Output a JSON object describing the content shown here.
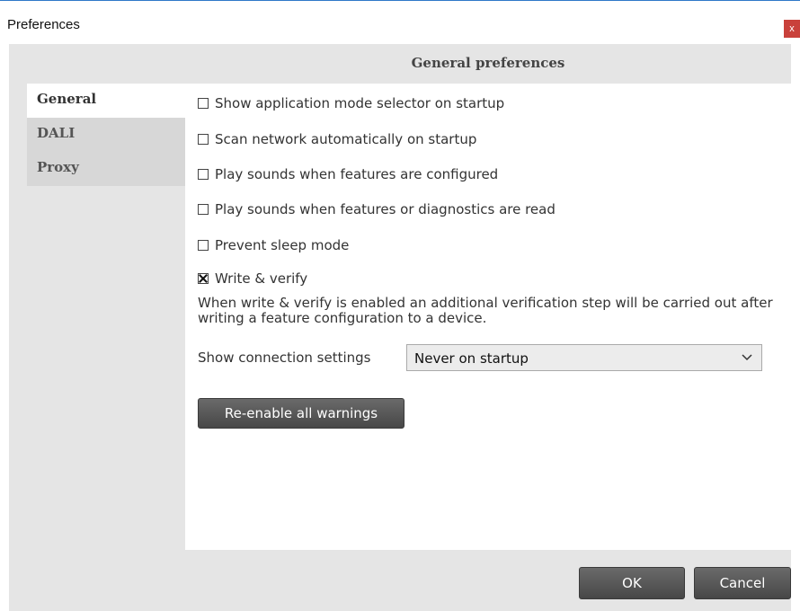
{
  "window": {
    "title": "Preferences",
    "close_label": "x"
  },
  "panel": {
    "heading": "General preferences"
  },
  "nav": {
    "items": [
      {
        "label": "General",
        "active": true
      },
      {
        "label": "DALI",
        "active": false
      },
      {
        "label": "Proxy",
        "active": false
      }
    ]
  },
  "options": [
    {
      "label": "Show application mode selector on startup",
      "checked": false
    },
    {
      "label": "Scan network automatically on startup",
      "checked": false
    },
    {
      "label": "Play sounds when features are configured",
      "checked": false
    },
    {
      "label": "Play sounds when features or diagnostics are read",
      "checked": false
    },
    {
      "label": "Prevent sleep mode",
      "checked": false
    },
    {
      "label": "Write & verify",
      "checked": true
    }
  ],
  "write_verify_description": "When write & verify is enabled an additional verification step will be carried out after writing a feature configuration to a device.",
  "connection_settings": {
    "label": "Show connection settings",
    "value": "Never on startup"
  },
  "buttons": {
    "reenable": "Re-enable all warnings",
    "ok": "OK",
    "cancel": "Cancel"
  },
  "colors": {
    "close_button": "#c9413b",
    "window_border": "#2f78c8",
    "button_dark": "#5a5a5a",
    "background_gray": "#e5e5e5"
  }
}
